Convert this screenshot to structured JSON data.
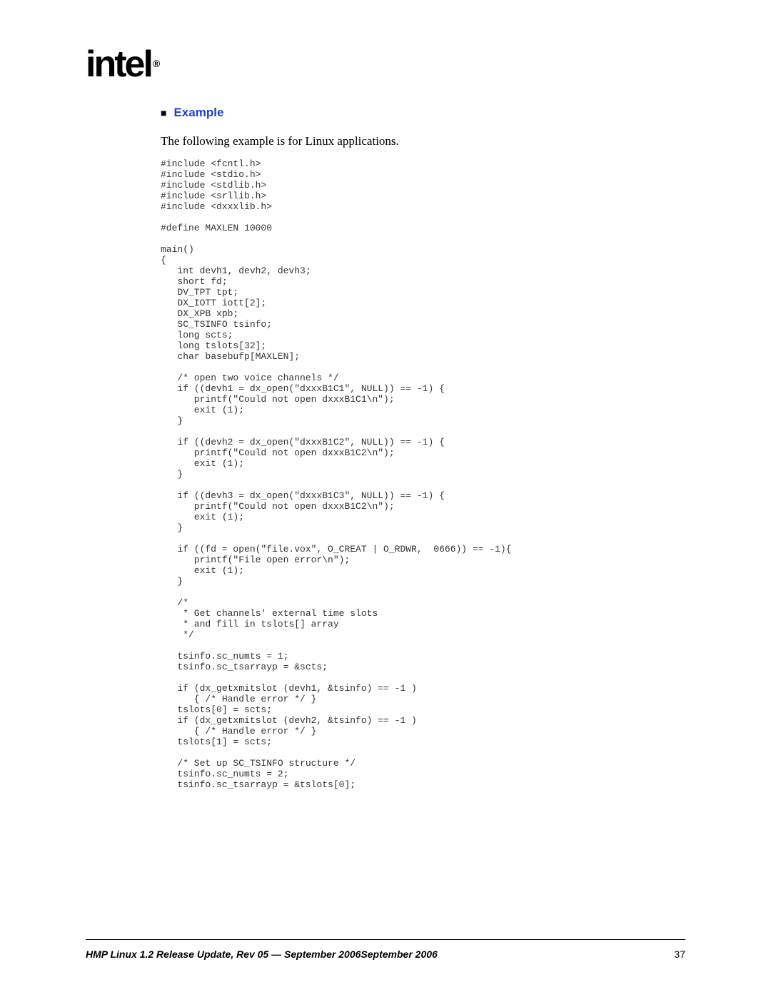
{
  "logo": {
    "text": "intel",
    "registered": "®"
  },
  "heading": {
    "bullet": "■",
    "text": "Example"
  },
  "intro": "The following example is for Linux applications.",
  "code": "#include <fcntl.h>\n#include <stdio.h>\n#include <stdlib.h>\n#include <srllib.h>\n#include <dxxxlib.h>\n\n#define MAXLEN 10000\n\nmain()\n{\n   int devh1, devh2, devh3;\n   short fd;\n   DV_TPT tpt;\n   DX_IOTT iott[2];\n   DX_XPB xpb;\n   SC_TSINFO tsinfo;\n   long scts;\n   long tslots[32];\n   char basebufp[MAXLEN];\n\n   /* open two voice channels */\n   if ((devh1 = dx_open(\"dxxxB1C1\", NULL)) == -1) {\n      printf(\"Could not open dxxxB1C1\\n\");\n      exit (1);\n   }\n\n   if ((devh2 = dx_open(\"dxxxB1C2\", NULL)) == -1) {\n      printf(\"Could not open dxxxB1C2\\n\");\n      exit (1);\n   }\n\n   if ((devh3 = dx_open(\"dxxxB1C3\", NULL)) == -1) {\n      printf(\"Could not open dxxxB1C2\\n\");\n      exit (1);\n   }\n\n   if ((fd = open(\"file.vox\", O_CREAT | O_RDWR,  0666)) == -1){\n      printf(\"File open error\\n\");\n      exit (1);\n   }\n\n   /*\n    * Get channels' external time slots\n    * and fill in tslots[] array\n    */\n\n   tsinfo.sc_numts = 1;\n   tsinfo.sc_tsarrayp = &scts;\n\n   if (dx_getxmitslot (devh1, &tsinfo) == -1 )\n      { /* Handle error */ }\n   tslots[0] = scts;\n   if (dx_getxmitslot (devh2, &tsinfo) == -1 )\n      { /* Handle error */ }\n   tslots[1] = scts;\n\n   /* Set up SC_TSINFO structure */\n   tsinfo.sc_numts = 2;\n   tsinfo.sc_tsarrayp = &tslots[0];",
  "footer": {
    "left": "HMP Linux 1.2 Release Update, Rev 05 — September 2006September 2006",
    "right": "37"
  }
}
